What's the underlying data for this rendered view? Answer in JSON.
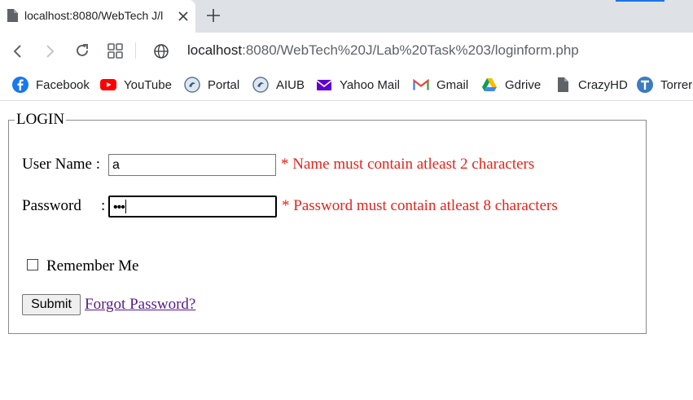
{
  "browser": {
    "tab": {
      "title": "localhost:8080/WebTech J/l"
    },
    "address": {
      "host": "localhost",
      "path": ":8080/WebTech%20J/Lab%20Task%203/loginform.php"
    }
  },
  "bookmarks": [
    {
      "label": "Facebook",
      "icon": "facebook-icon"
    },
    {
      "label": "YouTube",
      "icon": "youtube-icon"
    },
    {
      "label": "Portal",
      "icon": "portal-icon"
    },
    {
      "label": "AIUB",
      "icon": "aiub-icon"
    },
    {
      "label": "Yahoo Mail",
      "icon": "yahoo-mail-icon"
    },
    {
      "label": "Gmail",
      "icon": "gmail-icon"
    },
    {
      "label": "Gdrive",
      "icon": "gdrive-icon"
    },
    {
      "label": "CrazyHD",
      "icon": "file-icon"
    },
    {
      "label": "Torrer",
      "icon": "torrent-icon"
    }
  ],
  "form": {
    "legend": "LOGIN",
    "username": {
      "label": "User Name :",
      "value": "a",
      "error": "* Name must contain atleast 2 characters"
    },
    "password": {
      "label": "Password",
      "colon": ":",
      "masked": "•••",
      "error": "* Password must contain atleast 8 characters"
    },
    "remember": {
      "label": "Remember Me",
      "checked": false
    },
    "submit_label": "Submit",
    "forgot_label": "Forgot Password?"
  },
  "colors": {
    "error": "#e8221a",
    "link_visited": "#551a8b",
    "accent": "#1a73e8"
  }
}
